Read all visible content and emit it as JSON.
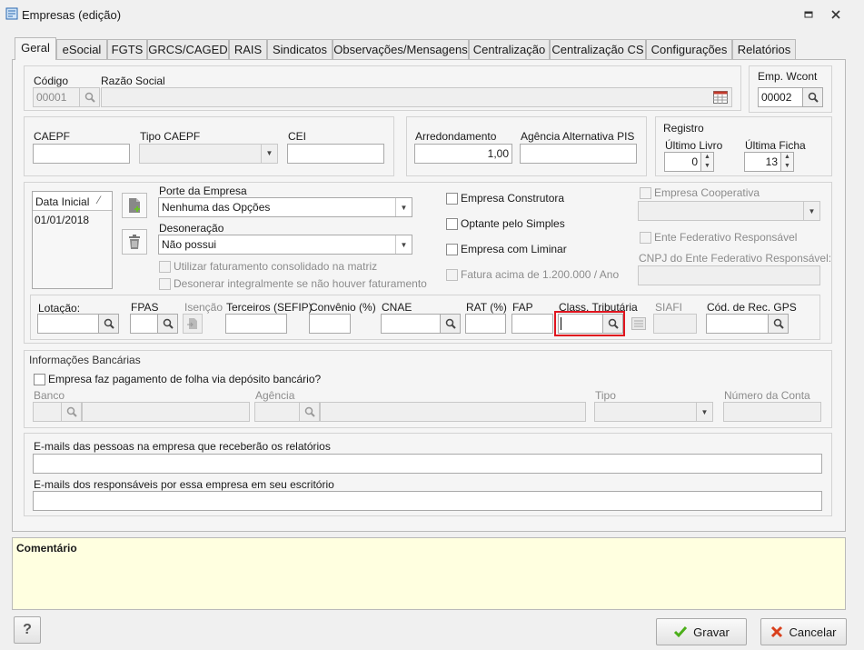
{
  "window": {
    "title": "Empresas (edição)",
    "pin_icon": "pin-icon",
    "close_icon": "close-icon"
  },
  "tabs": [
    {
      "label": "Geral",
      "active": true
    },
    {
      "label": "eSocial"
    },
    {
      "label": "FGTS"
    },
    {
      "label": "GRCS/CAGED"
    },
    {
      "label": "RAIS"
    },
    {
      "label": "Sindicatos"
    },
    {
      "label": "Observações/Mensagens"
    },
    {
      "label": "Centralização"
    },
    {
      "label": "Centralização CS"
    },
    {
      "label": "Configurações"
    },
    {
      "label": "Relatórios"
    }
  ],
  "top": {
    "codigo_label": "Código",
    "codigo_value": "00001",
    "razao_label": "Razão Social",
    "razao_value": "",
    "empwcont_label": "Emp. Wcont",
    "empwcont_value": "00002"
  },
  "caepf": {
    "caepf_label": "CAEPF",
    "tipo_label": "Tipo CAEPF",
    "cei_label": "CEI",
    "arred_label": "Arredondamento",
    "arred_value": "1,00",
    "agencia_pis_label": "Agência Alternativa PIS",
    "registro_label": "Registro",
    "livro_label": "Último Livro",
    "livro_value": "0",
    "ficha_label": "Última Ficha",
    "ficha_value": "13"
  },
  "middle": {
    "data_inicial_header": "Data Inicial",
    "data_inicial_row": "01/01/2018",
    "porte_label": "Porte da Empresa",
    "porte_value": "Nenhuma das Opções",
    "deson_label": "Desoneração",
    "deson_value": "Não possui",
    "util_fat": "Utilizar faturamento consolidado na matriz",
    "deson_integral": "Desonerar integralmente se não houver faturamento",
    "construtora": "Empresa Construtora",
    "simples": "Optante pelo Simples",
    "liminar": "Empresa com Liminar",
    "fatura": "Fatura acima de 1.200.000 / Ano",
    "cooperativa": "Empresa Cooperativa",
    "ente_fed": "Ente Federativo Responsável",
    "cnpj_ente": "CNPJ do Ente Federativo Responsável:"
  },
  "lotacao": {
    "lotacao": "Lotação:",
    "fpas": "FPAS",
    "isencao": "Isenção",
    "terceiros": "Terceiros (SEFIP)",
    "convenio": "Convênio (%)",
    "cnae": "CNAE",
    "rat": "RAT (%)",
    "fap": "FAP",
    "class_trib": "Class. Tributária",
    "siafi": "SIAFI",
    "cod_gps": "Cód. de Rec. GPS"
  },
  "banco": {
    "title": "Informações Bancárias",
    "deposito": "Empresa faz pagamento de folha via depósito bancário?",
    "banco": "Banco",
    "agencia": "Agência",
    "tipo": "Tipo",
    "numero_conta": "Número da Conta"
  },
  "emails": {
    "relatorios": "E-mails das pessoas na empresa que receberão os relatórios",
    "responsaveis": "E-mails dos responsáveis por essa empresa em seu escritório"
  },
  "comentario": {
    "label": "Comentário"
  },
  "footer": {
    "help": "?",
    "gravar": "Gravar",
    "cancelar": "Cancelar"
  },
  "colors": {
    "accent_highlight": "#e0141e",
    "comment_bg": "#ffffe0"
  }
}
